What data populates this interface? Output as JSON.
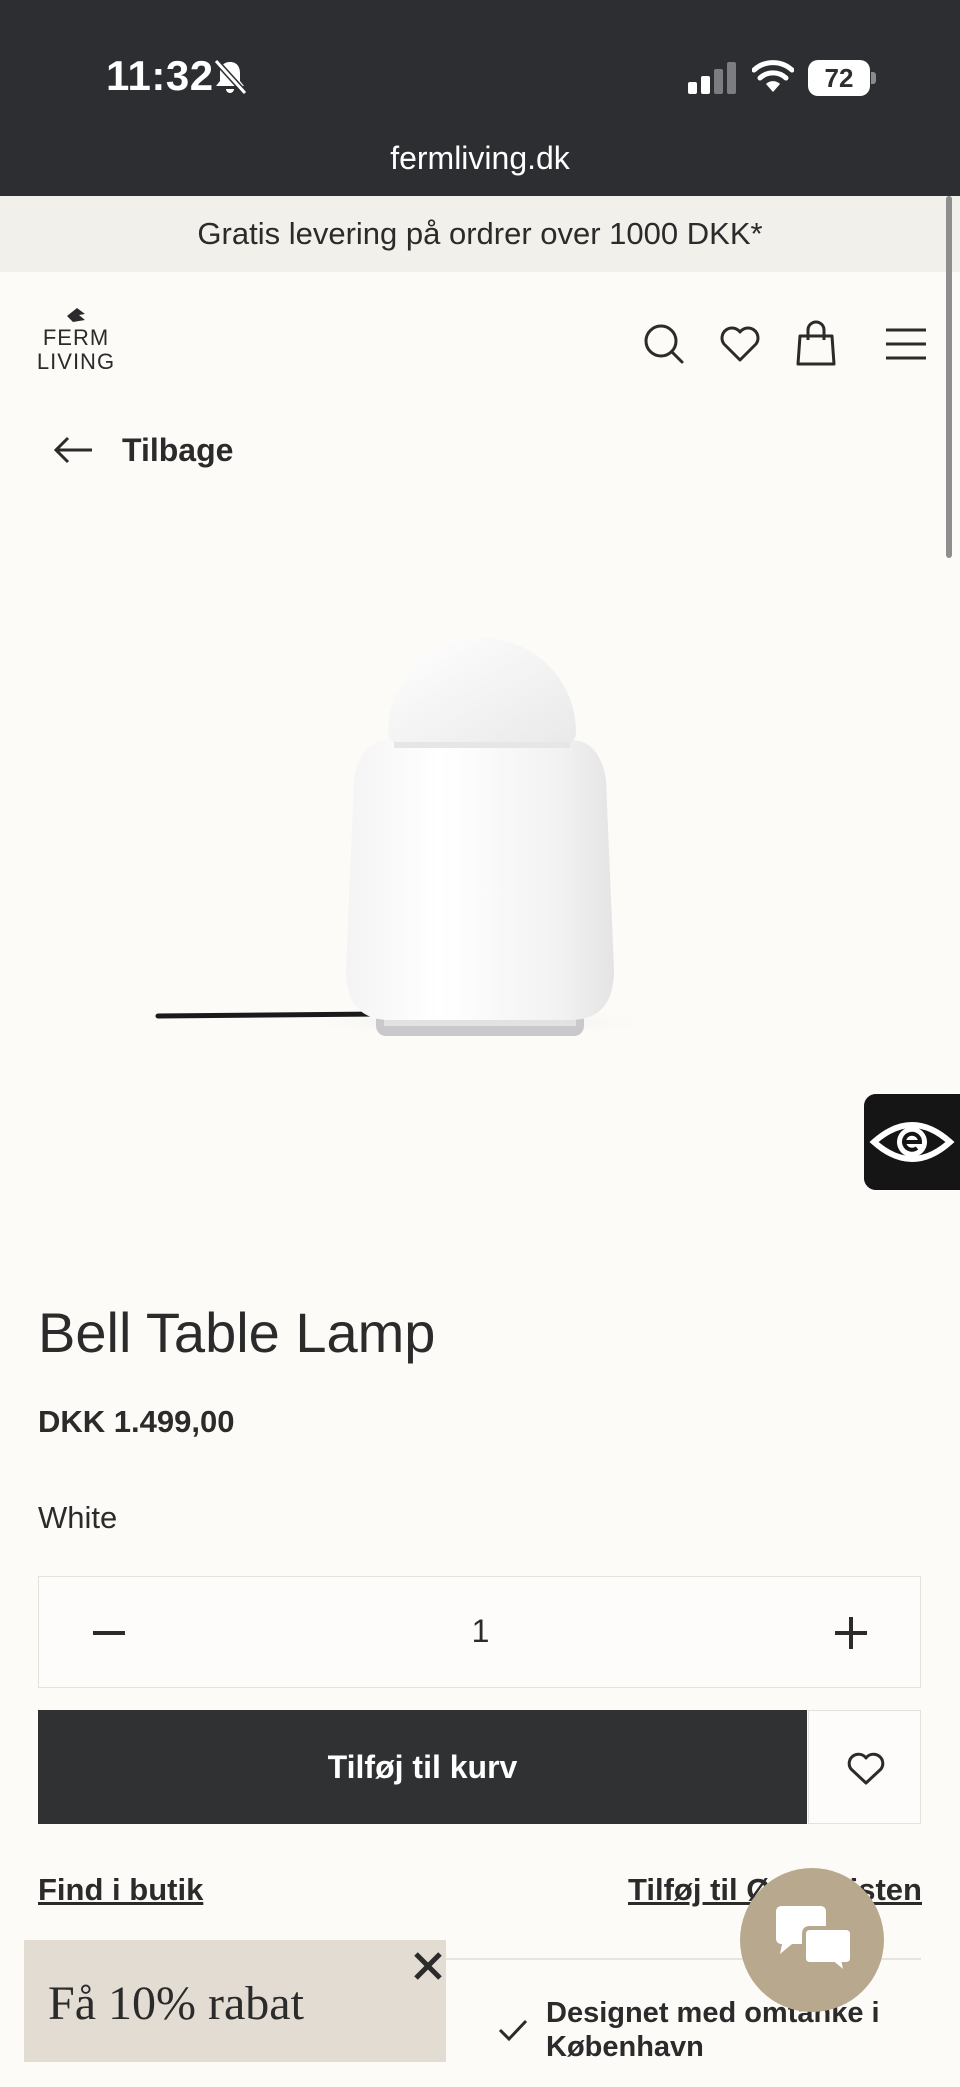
{
  "status_bar": {
    "time": "11:32",
    "battery": "72",
    "url": "fermliving.dk",
    "icons": [
      "bell-slash-icon",
      "signal-icon",
      "wifi-icon",
      "battery-icon"
    ]
  },
  "promo_banner": {
    "text": "Gratis levering på ordrer over 1000 DKK*"
  },
  "header": {
    "logo": [
      "FERM",
      "LIVING"
    ],
    "icons": [
      "search-icon",
      "heart-icon",
      "bag-icon",
      "menu-icon"
    ]
  },
  "nav": {
    "back_label": "Tilbage"
  },
  "product": {
    "title": "Bell Table Lamp",
    "price": "DKK 1.499,00",
    "variant": "White",
    "quantity": "1",
    "add_to_cart": "Tilføj til kurv",
    "find_in_store": "Find i butik",
    "add_to_list": "Tilføj til Ønskelisten"
  },
  "feature": {
    "text": "Designet med omtanke i København"
  },
  "discount_popup": {
    "text": "Få 10% rabat"
  },
  "colors": {
    "status_bar_bg": "#2c2e31",
    "page_bg": "#fcfbf8",
    "promo_bg": "#f2f0eb",
    "button_dark": "#2f3133",
    "discount_bg": "#e2dcd3",
    "chat_bg": "#b8a98e"
  }
}
